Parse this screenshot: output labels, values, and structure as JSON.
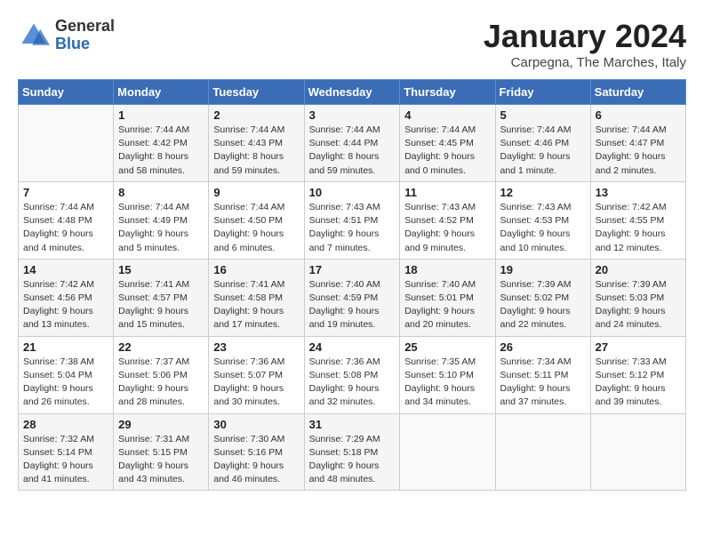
{
  "logo": {
    "general": "General",
    "blue": "Blue"
  },
  "header": {
    "month": "January 2024",
    "location": "Carpegna, The Marches, Italy"
  },
  "weekdays": [
    "Sunday",
    "Monday",
    "Tuesday",
    "Wednesday",
    "Thursday",
    "Friday",
    "Saturday"
  ],
  "weeks": [
    [
      {
        "day": "",
        "sunrise": "",
        "sunset": "",
        "daylight": "",
        "empty": true
      },
      {
        "day": "1",
        "sunrise": "Sunrise: 7:44 AM",
        "sunset": "Sunset: 4:42 PM",
        "daylight": "Daylight: 8 hours and 58 minutes."
      },
      {
        "day": "2",
        "sunrise": "Sunrise: 7:44 AM",
        "sunset": "Sunset: 4:43 PM",
        "daylight": "Daylight: 8 hours and 59 minutes."
      },
      {
        "day": "3",
        "sunrise": "Sunrise: 7:44 AM",
        "sunset": "Sunset: 4:44 PM",
        "daylight": "Daylight: 8 hours and 59 minutes."
      },
      {
        "day": "4",
        "sunrise": "Sunrise: 7:44 AM",
        "sunset": "Sunset: 4:45 PM",
        "daylight": "Daylight: 9 hours and 0 minutes."
      },
      {
        "day": "5",
        "sunrise": "Sunrise: 7:44 AM",
        "sunset": "Sunset: 4:46 PM",
        "daylight": "Daylight: 9 hours and 1 minute."
      },
      {
        "day": "6",
        "sunrise": "Sunrise: 7:44 AM",
        "sunset": "Sunset: 4:47 PM",
        "daylight": "Daylight: 9 hours and 2 minutes."
      }
    ],
    [
      {
        "day": "7",
        "sunrise": "Sunrise: 7:44 AM",
        "sunset": "Sunset: 4:48 PM",
        "daylight": "Daylight: 9 hours and 4 minutes."
      },
      {
        "day": "8",
        "sunrise": "Sunrise: 7:44 AM",
        "sunset": "Sunset: 4:49 PM",
        "daylight": "Daylight: 9 hours and 5 minutes."
      },
      {
        "day": "9",
        "sunrise": "Sunrise: 7:44 AM",
        "sunset": "Sunset: 4:50 PM",
        "daylight": "Daylight: 9 hours and 6 minutes."
      },
      {
        "day": "10",
        "sunrise": "Sunrise: 7:43 AM",
        "sunset": "Sunset: 4:51 PM",
        "daylight": "Daylight: 9 hours and 7 minutes."
      },
      {
        "day": "11",
        "sunrise": "Sunrise: 7:43 AM",
        "sunset": "Sunset: 4:52 PM",
        "daylight": "Daylight: 9 hours and 9 minutes."
      },
      {
        "day": "12",
        "sunrise": "Sunrise: 7:43 AM",
        "sunset": "Sunset: 4:53 PM",
        "daylight": "Daylight: 9 hours and 10 minutes."
      },
      {
        "day": "13",
        "sunrise": "Sunrise: 7:42 AM",
        "sunset": "Sunset: 4:55 PM",
        "daylight": "Daylight: 9 hours and 12 minutes."
      }
    ],
    [
      {
        "day": "14",
        "sunrise": "Sunrise: 7:42 AM",
        "sunset": "Sunset: 4:56 PM",
        "daylight": "Daylight: 9 hours and 13 minutes."
      },
      {
        "day": "15",
        "sunrise": "Sunrise: 7:41 AM",
        "sunset": "Sunset: 4:57 PM",
        "daylight": "Daylight: 9 hours and 15 minutes."
      },
      {
        "day": "16",
        "sunrise": "Sunrise: 7:41 AM",
        "sunset": "Sunset: 4:58 PM",
        "daylight": "Daylight: 9 hours and 17 minutes."
      },
      {
        "day": "17",
        "sunrise": "Sunrise: 7:40 AM",
        "sunset": "Sunset: 4:59 PM",
        "daylight": "Daylight: 9 hours and 19 minutes."
      },
      {
        "day": "18",
        "sunrise": "Sunrise: 7:40 AM",
        "sunset": "Sunset: 5:01 PM",
        "daylight": "Daylight: 9 hours and 20 minutes."
      },
      {
        "day": "19",
        "sunrise": "Sunrise: 7:39 AM",
        "sunset": "Sunset: 5:02 PM",
        "daylight": "Daylight: 9 hours and 22 minutes."
      },
      {
        "day": "20",
        "sunrise": "Sunrise: 7:39 AM",
        "sunset": "Sunset: 5:03 PM",
        "daylight": "Daylight: 9 hours and 24 minutes."
      }
    ],
    [
      {
        "day": "21",
        "sunrise": "Sunrise: 7:38 AM",
        "sunset": "Sunset: 5:04 PM",
        "daylight": "Daylight: 9 hours and 26 minutes."
      },
      {
        "day": "22",
        "sunrise": "Sunrise: 7:37 AM",
        "sunset": "Sunset: 5:06 PM",
        "daylight": "Daylight: 9 hours and 28 minutes."
      },
      {
        "day": "23",
        "sunrise": "Sunrise: 7:36 AM",
        "sunset": "Sunset: 5:07 PM",
        "daylight": "Daylight: 9 hours and 30 minutes."
      },
      {
        "day": "24",
        "sunrise": "Sunrise: 7:36 AM",
        "sunset": "Sunset: 5:08 PM",
        "daylight": "Daylight: 9 hours and 32 minutes."
      },
      {
        "day": "25",
        "sunrise": "Sunrise: 7:35 AM",
        "sunset": "Sunset: 5:10 PM",
        "daylight": "Daylight: 9 hours and 34 minutes."
      },
      {
        "day": "26",
        "sunrise": "Sunrise: 7:34 AM",
        "sunset": "Sunset: 5:11 PM",
        "daylight": "Daylight: 9 hours and 37 minutes."
      },
      {
        "day": "27",
        "sunrise": "Sunrise: 7:33 AM",
        "sunset": "Sunset: 5:12 PM",
        "daylight": "Daylight: 9 hours and 39 minutes."
      }
    ],
    [
      {
        "day": "28",
        "sunrise": "Sunrise: 7:32 AM",
        "sunset": "Sunset: 5:14 PM",
        "daylight": "Daylight: 9 hours and 41 minutes."
      },
      {
        "day": "29",
        "sunrise": "Sunrise: 7:31 AM",
        "sunset": "Sunset: 5:15 PM",
        "daylight": "Daylight: 9 hours and 43 minutes."
      },
      {
        "day": "30",
        "sunrise": "Sunrise: 7:30 AM",
        "sunset": "Sunset: 5:16 PM",
        "daylight": "Daylight: 9 hours and 46 minutes."
      },
      {
        "day": "31",
        "sunrise": "Sunrise: 7:29 AM",
        "sunset": "Sunset: 5:18 PM",
        "daylight": "Daylight: 9 hours and 48 minutes."
      },
      {
        "day": "",
        "sunrise": "",
        "sunset": "",
        "daylight": "",
        "empty": true
      },
      {
        "day": "",
        "sunrise": "",
        "sunset": "",
        "daylight": "",
        "empty": true
      },
      {
        "day": "",
        "sunrise": "",
        "sunset": "",
        "daylight": "",
        "empty": true
      }
    ]
  ]
}
